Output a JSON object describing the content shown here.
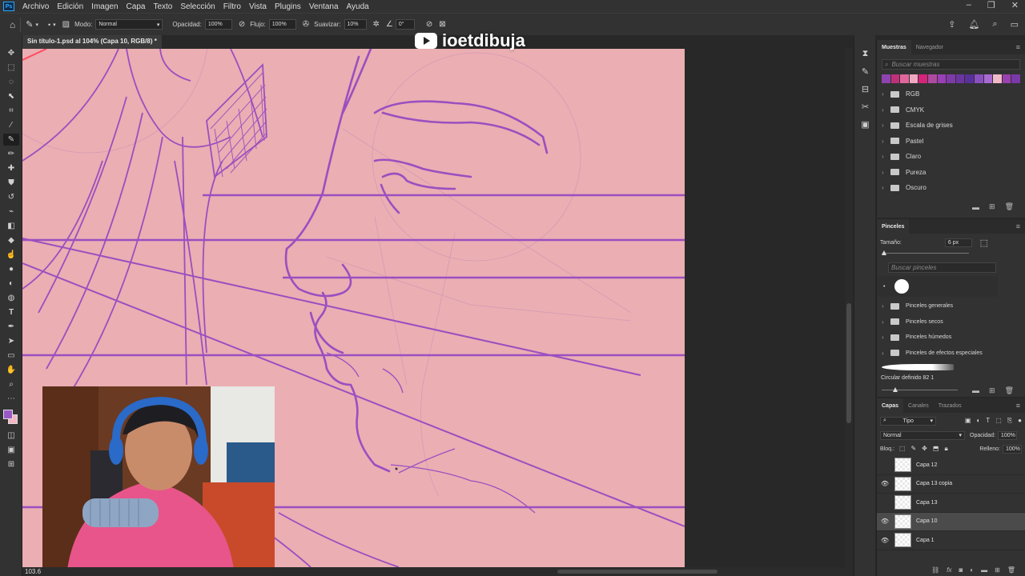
{
  "app": {
    "logo": "Ps"
  },
  "menu": [
    "Archivo",
    "Edición",
    "Imagen",
    "Capa",
    "Texto",
    "Selección",
    "Filtro",
    "Vista",
    "Plugins",
    "Ventana",
    "Ayuda"
  ],
  "options": {
    "mode_label": "Modo:",
    "mode_value": "Normal",
    "opacity_label": "Opacidad:",
    "opacity_value": "100%",
    "flow_label": "Flujo:",
    "flow_value": "100%",
    "smooth_label": "Suavizar:",
    "smooth_value": "10%",
    "angle_value": "0°"
  },
  "document": {
    "tab_title": "Sin título-1.psd al 104% (Capa 10, RGB/8) *",
    "zoom": "103.6"
  },
  "watermark": {
    "text": "ioetdibuja"
  },
  "swatches_panel": {
    "tabs": [
      "Muestras",
      "Navegador"
    ],
    "search_placeholder": "Buscar muestras",
    "colors": [
      "#8e44b0",
      "#c0307a",
      "#e0679b",
      "#f0a8c0",
      "#d4257a",
      "#b04aa0",
      "#9a3fb5",
      "#7e3aa8",
      "#6b35a0",
      "#5a2f9a",
      "#8a4fc0",
      "#a86ad0",
      "#f0b8c8",
      "#9b40b0",
      "#7a38a8"
    ],
    "groups": [
      "RGB",
      "CMYK",
      "Escala de grises",
      "Pastel",
      "Claro",
      "Pureza",
      "Oscuro"
    ]
  },
  "brushes_panel": {
    "title": "Pinceles",
    "size_label": "Tamaño:",
    "size_value": "6 px",
    "search_placeholder": "Buscar pinceles",
    "groups": [
      "Pinceles generales",
      "Pinceles secos",
      "Pinceles húmedos",
      "Pinceles de efectos especiales"
    ],
    "current_brush": "Circular definido 82 1"
  },
  "layers_panel": {
    "tabs": [
      "Capas",
      "Canales",
      "Trazados"
    ],
    "filter_label": "Tipo",
    "blend_mode": "Normal",
    "opacity_label": "Opacidad:",
    "opacity_value": "100%",
    "lock_label": "Bloq.:",
    "fill_label": "Relleno:",
    "fill_value": "100%",
    "layers": [
      {
        "name": "Capa 12",
        "visible": false,
        "selected": false
      },
      {
        "name": "Capa 13 copia",
        "visible": true,
        "selected": false
      },
      {
        "name": "Capa 13",
        "visible": false,
        "selected": false
      },
      {
        "name": "Capa 10",
        "visible": true,
        "selected": true
      },
      {
        "name": "Capa 1",
        "visible": true,
        "selected": false
      }
    ]
  },
  "colors": {
    "foreground": "#9b59c4",
    "background": "#f3b6c2",
    "canvas": "#ebaeb2",
    "stroke": "#9a4fc0"
  }
}
